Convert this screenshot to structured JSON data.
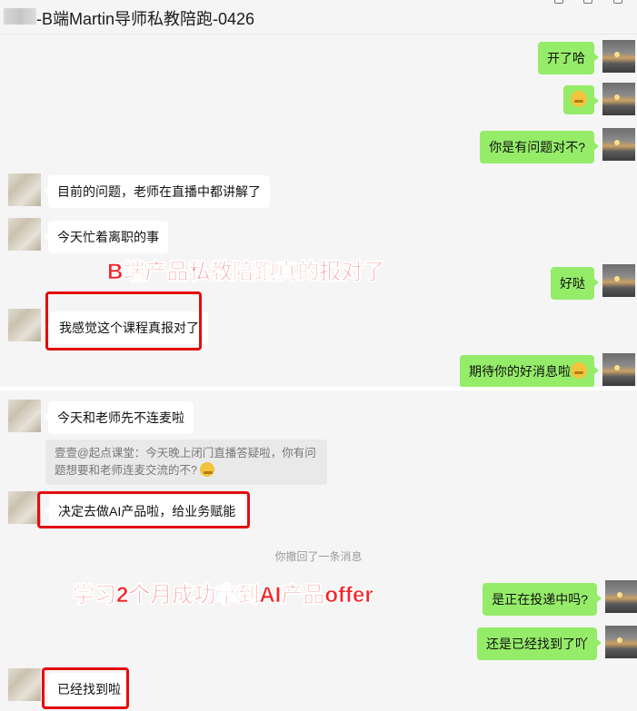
{
  "window": {
    "title": "-B端Martin导师私教陪跑-0426"
  },
  "messages": [
    {
      "side": "right",
      "text": "开了哈"
    },
    {
      "side": "right",
      "text": "",
      "emoji": "emoji-sticker"
    },
    {
      "side": "right",
      "text": "你是有问题对不?"
    },
    {
      "side": "left",
      "text": "目前的问题，老师在直播中都讲解了"
    },
    {
      "side": "left",
      "text": "今天忙着离职的事"
    },
    {
      "side": "right",
      "text": "好哒"
    },
    {
      "side": "left",
      "text": "我感觉这个课程真报对了"
    },
    {
      "side": "right",
      "text": "期待你的好消息啦"
    },
    {
      "side": "left",
      "text": "今天和老师先不连麦啦"
    },
    {
      "side": "left",
      "text": "决定去做AI产品啦，给业务赋能"
    },
    {
      "side": "right",
      "text": "是正在投递中吗?"
    },
    {
      "side": "right",
      "text": "还是已经找到了吖"
    },
    {
      "side": "left",
      "text": "已经找到啦"
    }
  ],
  "quote": {
    "text": "壹壹@起点课堂：今天晚上闭门直播答疑啦，你有问题想要和老师连麦交流的不?"
  },
  "system_note": "你撤回了一条消息",
  "annotations": {
    "top": "B端产品私教陪跑真的报对了",
    "bottom": "学习2个月成功拿到AI产品offer"
  },
  "colors": {
    "self_bubble": "#95ec69",
    "other_bubble": "#ffffff",
    "highlight": "#e30d0d",
    "annotation": "#f2252b"
  }
}
